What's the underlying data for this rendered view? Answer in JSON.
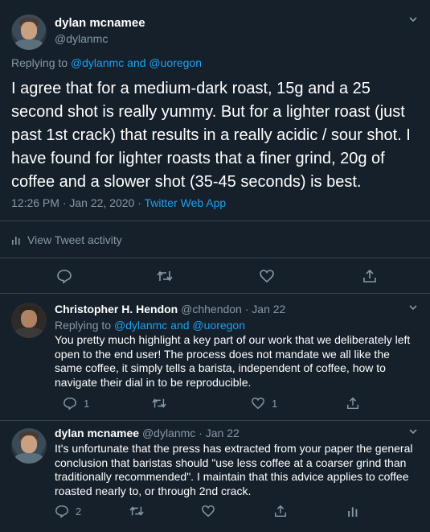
{
  "main_tweet": {
    "name": "dylan mcnamee",
    "handle": "@dylanmc",
    "replying_prefix": "Replying to ",
    "replying_to": "@dylanmc and @uoregon",
    "text": "I agree that for a medium-dark roast, 15g and a 25 second shot is really yummy. But for a lighter roast (just past 1st crack) that results in a really acidic / sour shot. I have found for lighter roasts that a finer grind, 20g of coffee and a slower shot (35-45 seconds) is best.",
    "timestamp": "12:26 PM · Jan 22, 2020 · ",
    "source": "Twitter Web App",
    "activity_label": "View Tweet activity"
  },
  "replies": [
    {
      "name": "Christopher H. Hendon",
      "handle_date": "@chhendon · Jan 22",
      "replying_prefix": "Replying to ",
      "replying_to": "@dylanmc and @uoregon",
      "text": "You pretty much highlight a key part of our work that we deliberately left open to the end user!  The process does not mandate we all like the same coffee, it simply tells a barista, independent of coffee, how to navigate their dial in to be reproducible.",
      "reply_count": "1",
      "like_count": "1"
    },
    {
      "name": "dylan mcnamee",
      "handle_date": "@dylanmc · Jan 22",
      "text": "It's unfortunate that the press has extracted from your paper the general conclusion that baristas should \"use less coffee at a coarser grind than traditionally recommended\". I maintain that this advice applies to coffee roasted nearly to, or through 2nd crack.",
      "reply_count": "2"
    }
  ],
  "icons": {
    "more": "chevron-down-icon",
    "reply": "reply-icon",
    "retweet": "retweet-icon",
    "like": "heart-icon",
    "share": "share-icon",
    "analytics": "analytics-icon"
  },
  "colors": {
    "background": "#15202b",
    "text": "#ffffff",
    "muted": "#8899a6",
    "accent": "#1da1f2",
    "divider": "#38444d"
  }
}
